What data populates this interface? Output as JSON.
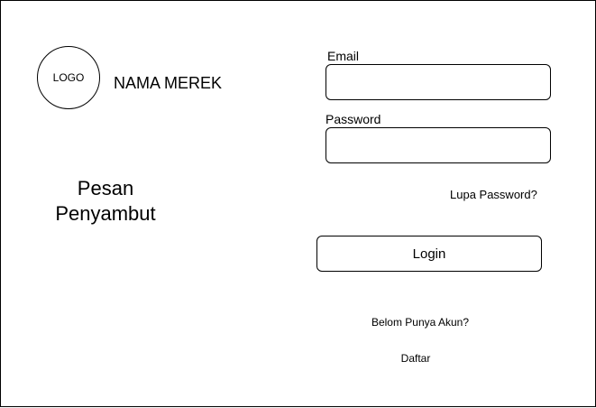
{
  "branding": {
    "logo_text": "LOGO",
    "brand_name": "NAMA MEREK"
  },
  "welcome": {
    "line1": "Pesan",
    "line2": "Penyambut"
  },
  "form": {
    "email_label": "Email",
    "email_value": "",
    "password_label": "Password",
    "password_value": "",
    "forgot_password": "Lupa Password?",
    "login_label": "Login"
  },
  "signup": {
    "prompt": "Belom Punya Akun?",
    "register_link": "Daftar"
  }
}
